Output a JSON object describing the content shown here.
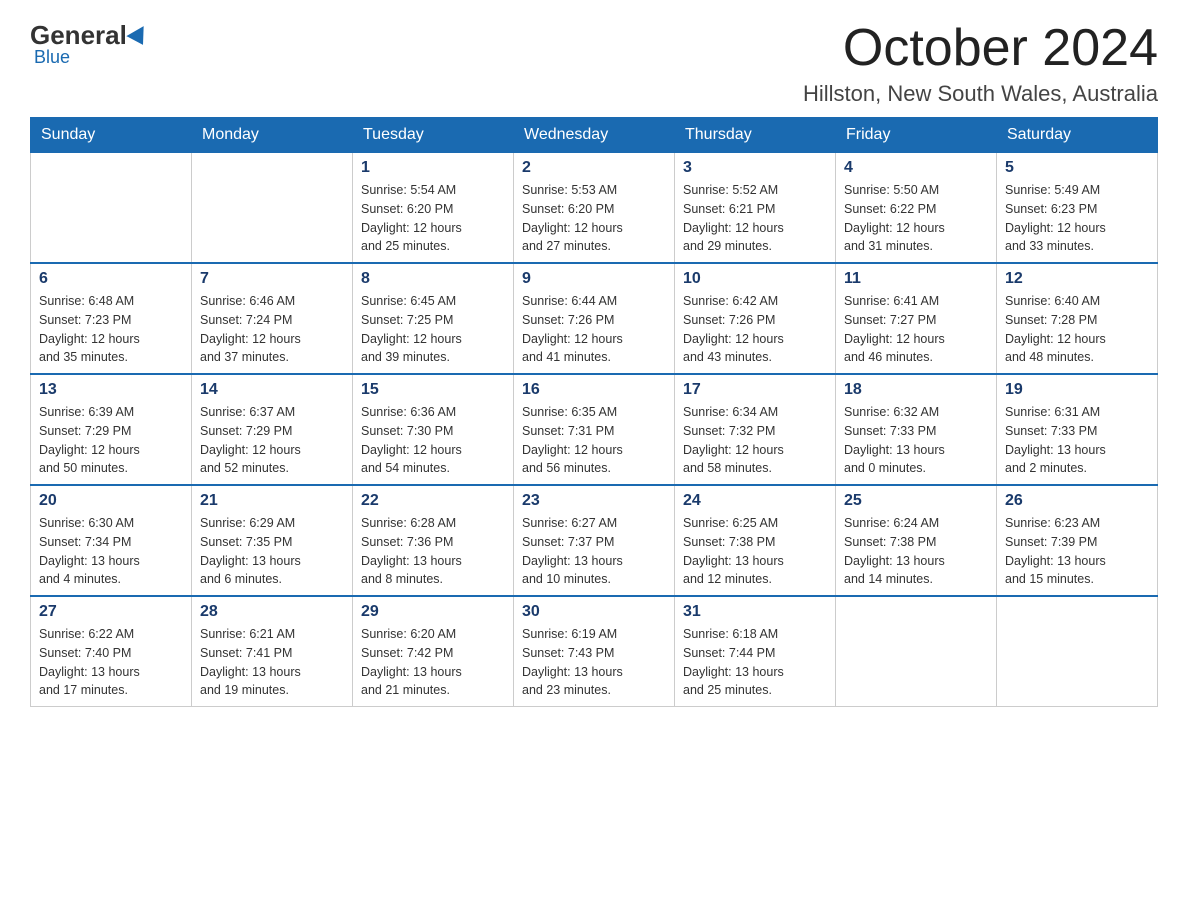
{
  "header": {
    "logo_general": "General",
    "logo_blue": "Blue",
    "month_year": "October 2024",
    "location": "Hillston, New South Wales, Australia"
  },
  "weekdays": [
    "Sunday",
    "Monday",
    "Tuesday",
    "Wednesday",
    "Thursday",
    "Friday",
    "Saturday"
  ],
  "weeks": [
    [
      {
        "day": "",
        "info": ""
      },
      {
        "day": "",
        "info": ""
      },
      {
        "day": "1",
        "info": "Sunrise: 5:54 AM\nSunset: 6:20 PM\nDaylight: 12 hours\nand 25 minutes."
      },
      {
        "day": "2",
        "info": "Sunrise: 5:53 AM\nSunset: 6:20 PM\nDaylight: 12 hours\nand 27 minutes."
      },
      {
        "day": "3",
        "info": "Sunrise: 5:52 AM\nSunset: 6:21 PM\nDaylight: 12 hours\nand 29 minutes."
      },
      {
        "day": "4",
        "info": "Sunrise: 5:50 AM\nSunset: 6:22 PM\nDaylight: 12 hours\nand 31 minutes."
      },
      {
        "day": "5",
        "info": "Sunrise: 5:49 AM\nSunset: 6:23 PM\nDaylight: 12 hours\nand 33 minutes."
      }
    ],
    [
      {
        "day": "6",
        "info": "Sunrise: 6:48 AM\nSunset: 7:23 PM\nDaylight: 12 hours\nand 35 minutes."
      },
      {
        "day": "7",
        "info": "Sunrise: 6:46 AM\nSunset: 7:24 PM\nDaylight: 12 hours\nand 37 minutes."
      },
      {
        "day": "8",
        "info": "Sunrise: 6:45 AM\nSunset: 7:25 PM\nDaylight: 12 hours\nand 39 minutes."
      },
      {
        "day": "9",
        "info": "Sunrise: 6:44 AM\nSunset: 7:26 PM\nDaylight: 12 hours\nand 41 minutes."
      },
      {
        "day": "10",
        "info": "Sunrise: 6:42 AM\nSunset: 7:26 PM\nDaylight: 12 hours\nand 43 minutes."
      },
      {
        "day": "11",
        "info": "Sunrise: 6:41 AM\nSunset: 7:27 PM\nDaylight: 12 hours\nand 46 minutes."
      },
      {
        "day": "12",
        "info": "Sunrise: 6:40 AM\nSunset: 7:28 PM\nDaylight: 12 hours\nand 48 minutes."
      }
    ],
    [
      {
        "day": "13",
        "info": "Sunrise: 6:39 AM\nSunset: 7:29 PM\nDaylight: 12 hours\nand 50 minutes."
      },
      {
        "day": "14",
        "info": "Sunrise: 6:37 AM\nSunset: 7:29 PM\nDaylight: 12 hours\nand 52 minutes."
      },
      {
        "day": "15",
        "info": "Sunrise: 6:36 AM\nSunset: 7:30 PM\nDaylight: 12 hours\nand 54 minutes."
      },
      {
        "day": "16",
        "info": "Sunrise: 6:35 AM\nSunset: 7:31 PM\nDaylight: 12 hours\nand 56 minutes."
      },
      {
        "day": "17",
        "info": "Sunrise: 6:34 AM\nSunset: 7:32 PM\nDaylight: 12 hours\nand 58 minutes."
      },
      {
        "day": "18",
        "info": "Sunrise: 6:32 AM\nSunset: 7:33 PM\nDaylight: 13 hours\nand 0 minutes."
      },
      {
        "day": "19",
        "info": "Sunrise: 6:31 AM\nSunset: 7:33 PM\nDaylight: 13 hours\nand 2 minutes."
      }
    ],
    [
      {
        "day": "20",
        "info": "Sunrise: 6:30 AM\nSunset: 7:34 PM\nDaylight: 13 hours\nand 4 minutes."
      },
      {
        "day": "21",
        "info": "Sunrise: 6:29 AM\nSunset: 7:35 PM\nDaylight: 13 hours\nand 6 minutes."
      },
      {
        "day": "22",
        "info": "Sunrise: 6:28 AM\nSunset: 7:36 PM\nDaylight: 13 hours\nand 8 minutes."
      },
      {
        "day": "23",
        "info": "Sunrise: 6:27 AM\nSunset: 7:37 PM\nDaylight: 13 hours\nand 10 minutes."
      },
      {
        "day": "24",
        "info": "Sunrise: 6:25 AM\nSunset: 7:38 PM\nDaylight: 13 hours\nand 12 minutes."
      },
      {
        "day": "25",
        "info": "Sunrise: 6:24 AM\nSunset: 7:38 PM\nDaylight: 13 hours\nand 14 minutes."
      },
      {
        "day": "26",
        "info": "Sunrise: 6:23 AM\nSunset: 7:39 PM\nDaylight: 13 hours\nand 15 minutes."
      }
    ],
    [
      {
        "day": "27",
        "info": "Sunrise: 6:22 AM\nSunset: 7:40 PM\nDaylight: 13 hours\nand 17 minutes."
      },
      {
        "day": "28",
        "info": "Sunrise: 6:21 AM\nSunset: 7:41 PM\nDaylight: 13 hours\nand 19 minutes."
      },
      {
        "day": "29",
        "info": "Sunrise: 6:20 AM\nSunset: 7:42 PM\nDaylight: 13 hours\nand 21 minutes."
      },
      {
        "day": "30",
        "info": "Sunrise: 6:19 AM\nSunset: 7:43 PM\nDaylight: 13 hours\nand 23 minutes."
      },
      {
        "day": "31",
        "info": "Sunrise: 6:18 AM\nSunset: 7:44 PM\nDaylight: 13 hours\nand 25 minutes."
      },
      {
        "day": "",
        "info": ""
      },
      {
        "day": "",
        "info": ""
      }
    ]
  ]
}
